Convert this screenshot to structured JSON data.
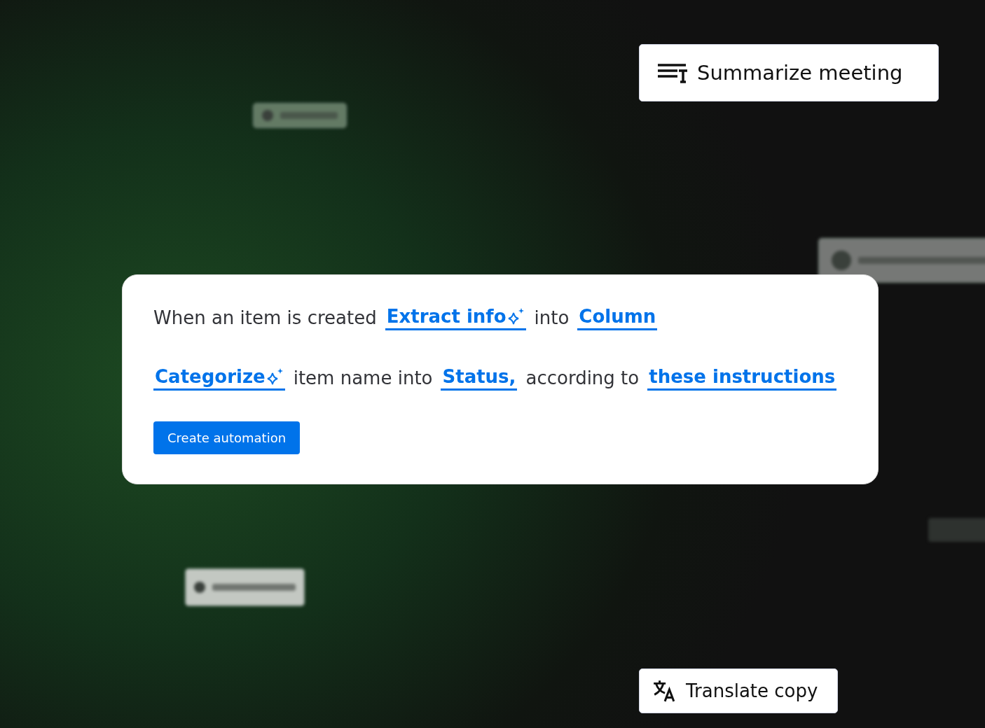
{
  "floating_chips": [
    {
      "label": "Summarize meeting"
    },
    {
      "label": "Translate copy"
    }
  ],
  "card": {
    "lines": [
      [
        {
          "kind": "text",
          "text": "When an item is created"
        },
        {
          "kind": "link",
          "text": "Extract info",
          "sparkle": true
        },
        {
          "kind": "text",
          "text": "into"
        },
        {
          "kind": "link",
          "text": "Column",
          "sparkle": false
        }
      ],
      [
        {
          "kind": "link",
          "text": "Categorize",
          "sparkle": true
        },
        {
          "kind": "text",
          "text": "item name into"
        },
        {
          "kind": "link",
          "text": "Status,",
          "sparkle": false
        },
        {
          "kind": "text",
          "text": "according to"
        },
        {
          "kind": "link",
          "text": "these instructions",
          "sparkle": false
        }
      ]
    ],
    "button": "Create automation"
  }
}
